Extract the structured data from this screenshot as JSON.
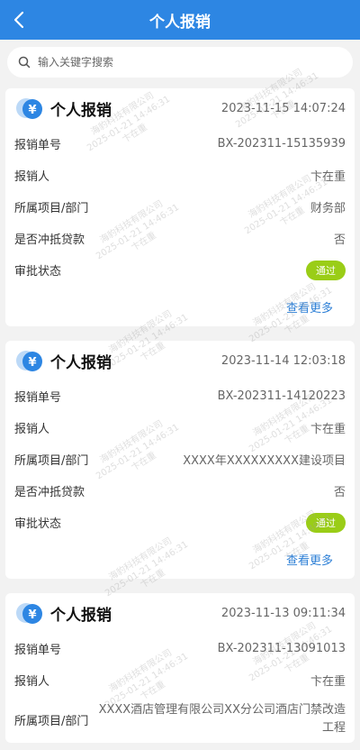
{
  "header": {
    "title": "个人报销"
  },
  "search": {
    "placeholder": "输入关键字搜索"
  },
  "labels": {
    "number": "报销单号",
    "person": "报销人",
    "project": "所属项目/部门",
    "offset": "是否冲抵贷款",
    "status": "审批状态",
    "more": "查看更多"
  },
  "cards": [
    {
      "title": "个人报销",
      "date": "2023-11-15 14:07:24",
      "number": "BX-202311-15135939",
      "person": "卞在重",
      "project": "财务部",
      "offset": "否",
      "status": "通过"
    },
    {
      "title": "个人报销",
      "date": "2023-11-14 12:03:18",
      "number": "BX-202311-14120223",
      "person": "卞在重",
      "project": "XXXX年XXXXXXXXX建设项目",
      "offset": "否",
      "status": "通过"
    },
    {
      "title": "个人报销",
      "date": "2023-11-13 09:11:34",
      "number": "BX-202311-13091013",
      "person": "卞在重",
      "project": "XXXX酒店管理有限公司XX分公司酒店门禁改造工程"
    }
  ],
  "watermark": {
    "line1": "海豹科技有限公司",
    "line2": "2025-01-21 14:46:31",
    "line3": "卞在重"
  },
  "colors": {
    "header": "#2d86e3",
    "badge": "#9acd17",
    "link": "#2d7fd6"
  },
  "icons": {
    "back": "chevron-left-icon",
    "search": "search-icon",
    "card": "yen-coin-icon"
  }
}
